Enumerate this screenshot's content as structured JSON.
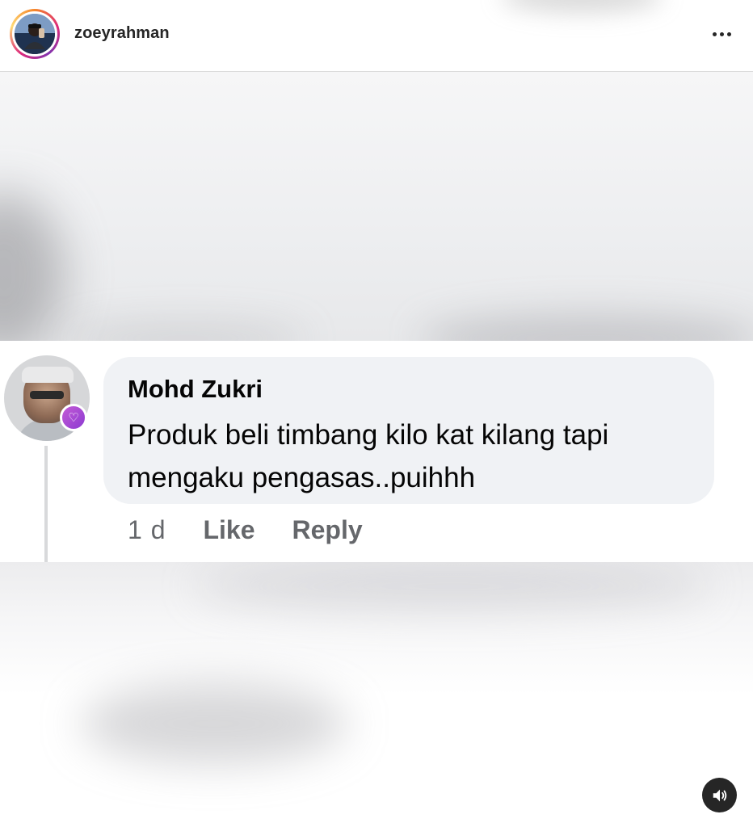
{
  "header": {
    "username": "zoeyrahman",
    "avatar_icon": "profile-photo-icon",
    "more_icon": "more-horizontal-icon"
  },
  "comment": {
    "author": "Mohd Zukri",
    "text": "Produk beli timbang kilo kat kilang tapi mengaku pengasas..puihhh",
    "time": "1 d",
    "like_label": "Like",
    "reply_label": "Reply",
    "badge_icon": "heart-badge-icon"
  },
  "media": {
    "audio_icon": "speaker-icon"
  },
  "colors": {
    "text_primary": "#050505",
    "text_secondary": "#65676b",
    "bubble_bg": "#f0f2f5",
    "badge": "#c45ad6"
  }
}
